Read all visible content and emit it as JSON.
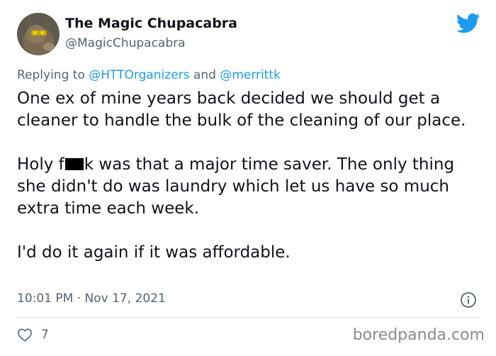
{
  "tweet": {
    "author": {
      "name": "The Magic Chupacabra",
      "handle": "@MagicChupacabra"
    },
    "reply": {
      "prefix": "Replying to ",
      "user1": "@HTTOrganizers",
      "joiner": " and ",
      "user2": "@merrittk"
    },
    "text": {
      "para1": "One ex of mine years back decided we should get a cleaner to handle the bulk of the cleaning of our place.",
      "para2_a": "Holy f",
      "para2_b": "k was that a major time saver.  The only thing she didn't do was laundry which let us have so much extra time each week.",
      "para3": "I'd do it again if it was affordable."
    },
    "timestamp": "10:01 PM · Nov 17, 2021",
    "likes": "7"
  },
  "watermark": "boredpanda.com",
  "colors": {
    "text": "#0f1419",
    "secondary": "#536471",
    "link": "#1d9bf0",
    "brand": "#1d9bf0"
  },
  "icons": [
    "twitter-bird-icon",
    "info-icon",
    "heart-icon"
  ]
}
